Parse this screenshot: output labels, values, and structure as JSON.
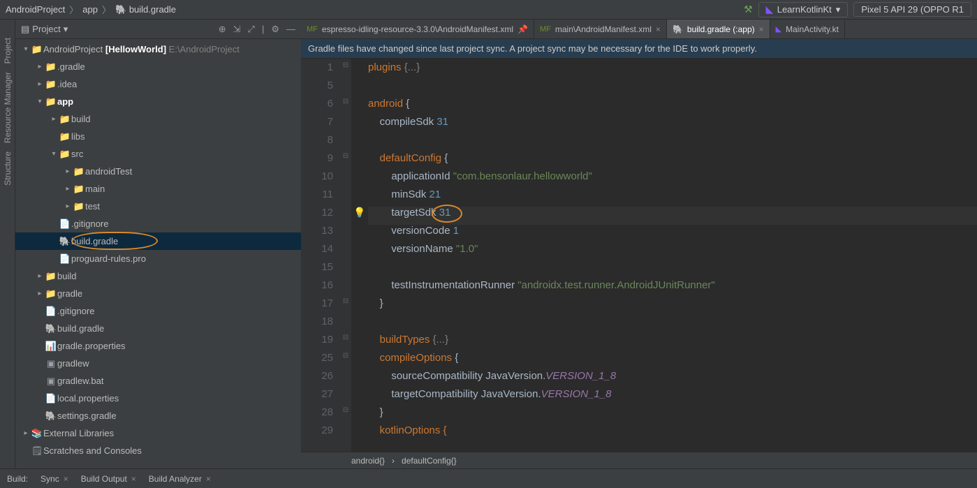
{
  "breadcrumbs": [
    "AndroidProject",
    "app",
    "build.gradle"
  ],
  "runConfig": "LearnKotlinKt",
  "device": "Pixel 5 API 29 (OPPO R1",
  "leftRail": [
    "Project",
    "Resource Manager",
    "Structure"
  ],
  "projectPanel": {
    "title": "Project"
  },
  "tree": [
    {
      "indent": 0,
      "chev": "▾",
      "icon": "📁",
      "cls": "folder-gray",
      "label": "AndroidProject",
      "extra": "[HellowWorld]",
      "path": "E:\\AndroidProject"
    },
    {
      "indent": 1,
      "chev": "▸",
      "icon": "📁",
      "cls": "folder-orange",
      "label": ".gradle"
    },
    {
      "indent": 1,
      "chev": "▸",
      "icon": "📁",
      "cls": "folder-gray",
      "label": ".idea"
    },
    {
      "indent": 1,
      "chev": "▾",
      "icon": "📁",
      "cls": "folder-blue",
      "label": "app",
      "bold": true
    },
    {
      "indent": 2,
      "chev": "▸",
      "icon": "📁",
      "cls": "folder-orange",
      "label": "build"
    },
    {
      "indent": 2,
      "chev": "",
      "icon": "📁",
      "cls": "folder-gray",
      "label": "libs"
    },
    {
      "indent": 2,
      "chev": "▾",
      "icon": "📁",
      "cls": "folder-gray",
      "label": "src"
    },
    {
      "indent": 3,
      "chev": "▸",
      "icon": "📁",
      "cls": "folder-gray",
      "label": "androidTest"
    },
    {
      "indent": 3,
      "chev": "▸",
      "icon": "📁",
      "cls": "folder-gray",
      "label": "main"
    },
    {
      "indent": 3,
      "chev": "▸",
      "icon": "📁",
      "cls": "folder-gray",
      "label": "test"
    },
    {
      "indent": 2,
      "chev": "",
      "icon": "📄",
      "cls": "file-icon",
      "label": ".gitignore"
    },
    {
      "indent": 2,
      "chev": "",
      "icon": "🐘",
      "cls": "gradle-icon",
      "label": "build.gradle",
      "selected": true,
      "circled": true
    },
    {
      "indent": 2,
      "chev": "",
      "icon": "📄",
      "cls": "file-icon",
      "label": "proguard-rules.pro"
    },
    {
      "indent": 1,
      "chev": "▸",
      "icon": "📁",
      "cls": "folder-orange",
      "label": "build"
    },
    {
      "indent": 1,
      "chev": "▸",
      "icon": "📁",
      "cls": "folder-gray",
      "label": "gradle"
    },
    {
      "indent": 1,
      "chev": "",
      "icon": "📄",
      "cls": "file-icon",
      "label": ".gitignore"
    },
    {
      "indent": 1,
      "chev": "",
      "icon": "🐘",
      "cls": "gradle-icon",
      "label": "build.gradle"
    },
    {
      "indent": 1,
      "chev": "",
      "icon": "📊",
      "cls": "file-icon",
      "label": "gradle.properties"
    },
    {
      "indent": 1,
      "chev": "",
      "icon": "▣",
      "cls": "file-icon",
      "label": "gradlew"
    },
    {
      "indent": 1,
      "chev": "",
      "icon": "▣",
      "cls": "file-icon",
      "label": "gradlew.bat"
    },
    {
      "indent": 1,
      "chev": "",
      "icon": "📄",
      "cls": "file-icon",
      "label": "local.properties"
    },
    {
      "indent": 1,
      "chev": "",
      "icon": "🐘",
      "cls": "gradle-icon",
      "label": "settings.gradle"
    },
    {
      "indent": 0,
      "chev": "▸",
      "icon": "📚",
      "cls": "file-icon",
      "label": "External Libraries"
    },
    {
      "indent": 0,
      "chev": "",
      "icon": "🗒",
      "cls": "file-icon",
      "label": "Scratches and Consoles"
    }
  ],
  "tabs": [
    {
      "icon": "manifest",
      "label": "espresso-idling-resource-3.3.0\\AndroidManifest.xml",
      "pinned": true
    },
    {
      "icon": "manifest",
      "label": "main\\AndroidManifest.xml",
      "close": true
    },
    {
      "icon": "gradle",
      "label": "build.gradle (:app)",
      "close": true,
      "active": true
    },
    {
      "icon": "kotlin",
      "label": "MainActivity.kt"
    }
  ],
  "infobar": "Gradle files have changed since last project sync. A project sync may be necessary for the IDE to work properly.",
  "lines": [
    {
      "n": "1",
      "fold": "⊟",
      "html": "<span class='kw'>plugins</span> <span class='fold-dots'>{...}</span>"
    },
    {
      "n": "5",
      "html": ""
    },
    {
      "n": "6",
      "fold": "⊟",
      "html": "<span class='kw'>android</span> <span class='ident'>{</span>"
    },
    {
      "n": "7",
      "html": "    <span class='fn'>compileSdk</span> <span class='num'>31</span>"
    },
    {
      "n": "8",
      "html": ""
    },
    {
      "n": "9",
      "fold": "⊟",
      "html": "    <span class='kw'>defaultConfig</span> <span class='ident'>{</span>"
    },
    {
      "n": "10",
      "html": "        <span class='fn'>applicationId</span> <span class='str'>\"com.bensonlaur.hellowworld\"</span>"
    },
    {
      "n": "11",
      "html": "        <span class='fn'>minSdk</span> <span class='num'>21</span>"
    },
    {
      "n": "12",
      "bulb": true,
      "hl": true,
      "html": "        <span class='fn'>targetSdk</span> <span class='num circle31'>31</span>"
    },
    {
      "n": "13",
      "html": "        <span class='fn'>versionCode</span> <span class='num'>1</span>"
    },
    {
      "n": "14",
      "html": "        <span class='fn'>versionName</span> <span class='str'>\"1.0\"</span>"
    },
    {
      "n": "15",
      "html": ""
    },
    {
      "n": "16",
      "html": "        <span class='fn'>testInstrumentationRunner</span> <span class='str'>\"androidx.test.runner.AndroidJUnitRunner\"</span>"
    },
    {
      "n": "17",
      "fold": "⊟",
      "html": "    <span class='ident'>}</span>"
    },
    {
      "n": "18",
      "html": ""
    },
    {
      "n": "19",
      "fold": "⊟",
      "html": "    <span class='kw'>buildTypes</span> <span class='fold-dots'>{...}</span>"
    },
    {
      "n": "25",
      "fold": "⊟",
      "html": "    <span class='kw'>compileOptions</span> <span class='ident'>{</span>"
    },
    {
      "n": "26",
      "html": "        <span class='fn'>sourceCompatibility</span> <span class='ident'>JavaVersion.</span><span class='pkg'>VERSION_1_8</span>"
    },
    {
      "n": "27",
      "html": "        <span class='fn'>targetCompatibility</span> <span class='ident'>JavaVersion.</span><span class='pkg'>VERSION_1_8</span>"
    },
    {
      "n": "28",
      "fold": "⊟",
      "html": "    <span class='ident'>}</span>"
    },
    {
      "n": "29",
      "html": "    <span class='kw dim'>kotlinOptions {</span>"
    }
  ],
  "editorCrumbs": [
    "android{}",
    "defaultConfig{}"
  ],
  "bottom": {
    "label": "Build:",
    "tabs": [
      "Sync",
      "Build Output",
      "Build Analyzer"
    ]
  }
}
